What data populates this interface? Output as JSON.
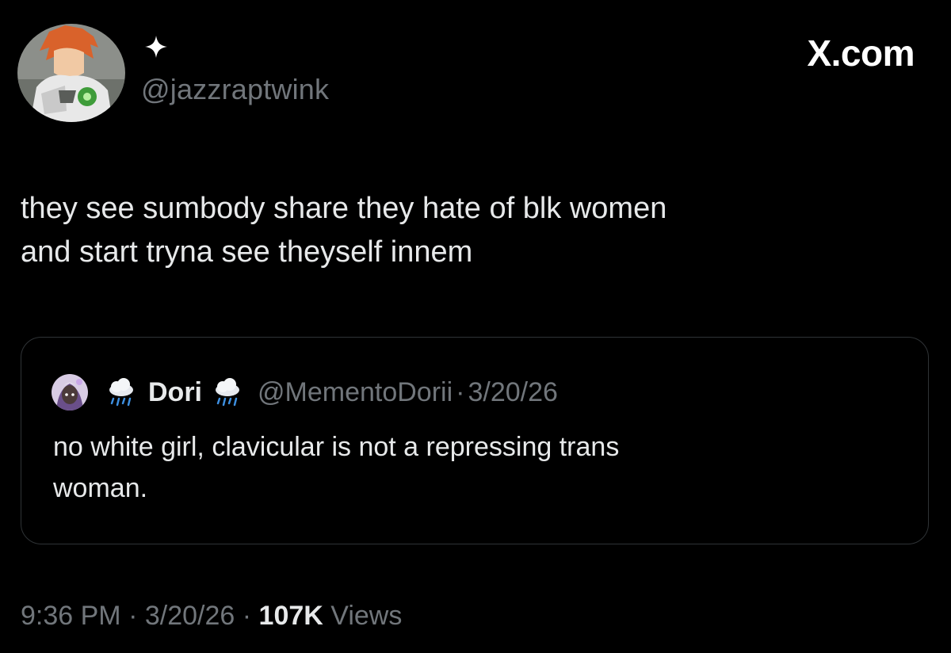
{
  "author": {
    "avatar": "avatar-image",
    "badge_icon": "sparkle-icon",
    "handle": "@jazzraptwink"
  },
  "brand": {
    "label": "X.com"
  },
  "tweet": {
    "lines": [
      "they see sumbody share they hate of blk women",
      "and start tryna see theyself innem"
    ]
  },
  "quote": {
    "avatar": "avatar-image",
    "emoji_icon": "rain-cloud-icon",
    "name": "Dori",
    "handle": "@MementoDorii",
    "separator": "·",
    "date": "3/20/26",
    "lines": [
      "no white girl, clavicular is not a repressing trans",
      "woman."
    ]
  },
  "meta": {
    "time": "9:36 PM",
    "sep1": "·",
    "date": "3/20/26",
    "sep2": "·",
    "views_count": "107K",
    "views_label": "Views"
  },
  "colors": {
    "background": "#000000",
    "text": "#e7e9ea",
    "secondary": "#71767b",
    "border": "#2f3336"
  }
}
